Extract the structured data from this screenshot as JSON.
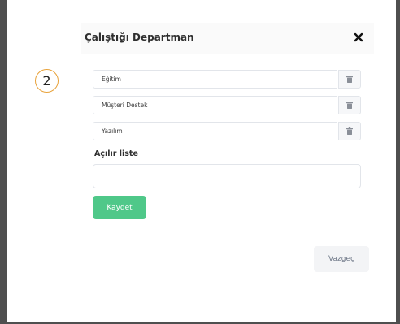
{
  "modal": {
    "title": "Çalıştığı Departman",
    "close_icon": "close-icon"
  },
  "step_badge": "2",
  "departments": [
    {
      "value": "Eğitim",
      "delete_icon": "trash-icon"
    },
    {
      "value": "Müşteri Destek",
      "delete_icon": "trash-icon"
    },
    {
      "value": "Yazılım",
      "delete_icon": "trash-icon"
    }
  ],
  "dropdown_list": {
    "label": "Açılır liste",
    "value": ""
  },
  "buttons": {
    "save_label": "Kaydet",
    "cancel_label": "Vazgeç"
  },
  "colors": {
    "save_button": "#4fc889",
    "badge_border": "#e8a23a",
    "frame": "#4f4f4f"
  }
}
